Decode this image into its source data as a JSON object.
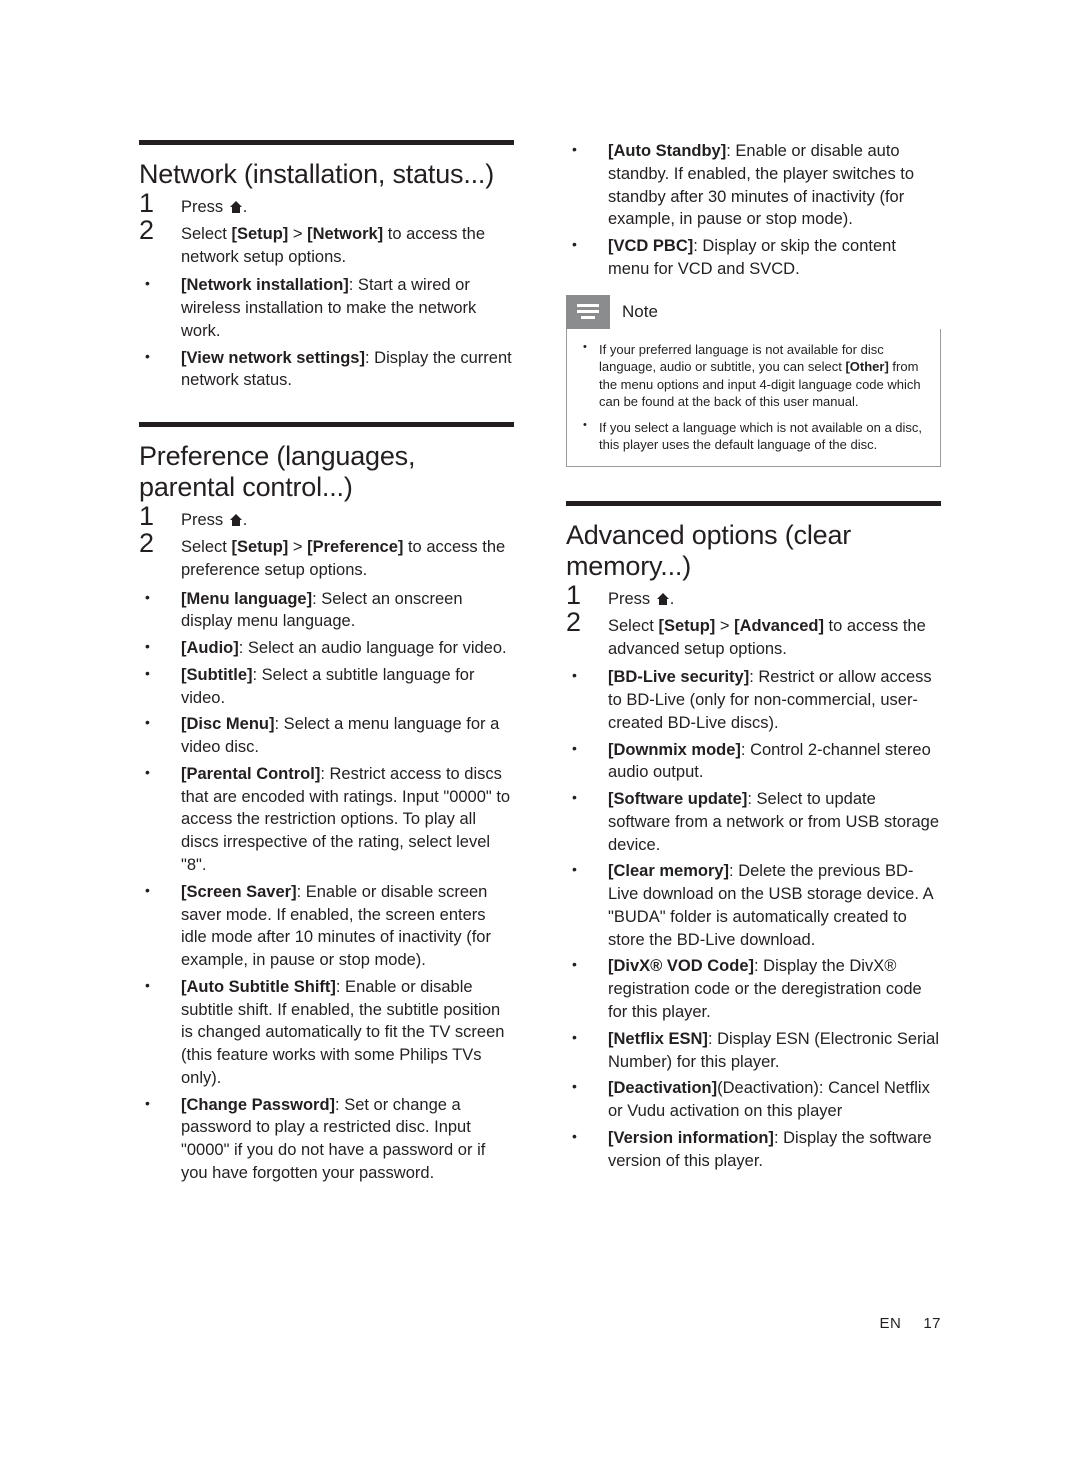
{
  "left_column": {
    "sections": [
      {
        "title": "Network (installation, status...)",
        "steps": [
          {
            "num": "1",
            "text": "Press ",
            "icon": "home-icon",
            "after": "."
          },
          {
            "num": "2",
            "text_parts": [
              "Select ",
              "[Setup]",
              " > ",
              "[Network]",
              " to access the network setup options."
            ]
          }
        ],
        "bullets": [
          {
            "term": "[Network installation]",
            "text": ": Start a wired or wireless installation to make the network work."
          },
          {
            "term": "[View network settings]",
            "text": ": Display the current network status."
          }
        ]
      },
      {
        "title": "Preference (languages, parental control...)",
        "steps": [
          {
            "num": "1",
            "text": "Press ",
            "icon": "home-icon",
            "after": "."
          },
          {
            "num": "2",
            "text_parts": [
              "Select ",
              "[Setup]",
              " > ",
              "[Preference]",
              " to access the preference setup options."
            ]
          }
        ],
        "bullets": [
          {
            "term": "[Menu language]",
            "text": ": Select an onscreen display menu language."
          },
          {
            "term": "[Audio]",
            "text": ": Select an audio language for video."
          },
          {
            "term": "[Subtitle]",
            "text": ": Select a subtitle language for video."
          },
          {
            "term": "[Disc Menu]",
            "text": ": Select a menu language for a video disc."
          },
          {
            "term": "[Parental Control]",
            "text": ": Restrict access to discs that are encoded with ratings. Input \"0000\" to access the restriction options. To play all discs irrespective of the rating, select level \"8\"."
          },
          {
            "term": "[Screen Saver]",
            "text": ": Enable or disable screen saver mode. If enabled, the screen enters idle mode after 10 minutes of inactivity (for example, in pause or stop mode)."
          },
          {
            "term": "[Auto Subtitle Shift]",
            "text": ": Enable or disable subtitle shift. If enabled, the subtitle position is changed automatically to fit the TV screen (this feature works with some Philips TVs only)."
          },
          {
            "term": "[Change Password]",
            "text": ": Set or change a password to play a restricted disc. Input \"0000\" if you do not have a password or if you have forgotten your password."
          }
        ]
      }
    ]
  },
  "right_column": {
    "top_bullets": [
      {
        "term": "[Auto Standby]",
        "text": ": Enable or disable auto standby. If enabled, the player switches to standby after 30 minutes of inactivity (for example, in pause or stop mode)."
      },
      {
        "term": "[VCD PBC]",
        "text": ": Display or skip the content menu for VCD and SVCD."
      }
    ],
    "note": {
      "title": "Note",
      "items": [
        {
          "pre": "If your preferred language is not available for disc language, audio or subtitle, you can select ",
          "term": "[Other]",
          "post": " from the menu options and input 4-digit language code which can be found at the back of this user manual."
        },
        {
          "pre": "If you select a language which is not available on a disc, this player uses the default language of the disc.",
          "term": "",
          "post": ""
        }
      ]
    },
    "section": {
      "title": "Advanced options (clear memory...)",
      "steps": [
        {
          "num": "1",
          "text": "Press ",
          "icon": "home-icon",
          "after": "."
        },
        {
          "num": "2",
          "text_parts": [
            "Select ",
            "[Setup]",
            " > ",
            "[Advanced]",
            " to access the advanced setup options."
          ]
        }
      ],
      "bullets": [
        {
          "term": "[BD-Live security]",
          "text": ": Restrict or allow access to BD-Live (only for non-commercial, user-created BD-Live discs)."
        },
        {
          "term": "[Downmix mode]",
          "text": ": Control 2-channel stereo audio output."
        },
        {
          "term": "[Software update]",
          "text": ": Select to update software from a network or from USB storage device."
        },
        {
          "term": "[Clear memory]",
          "text": ": Delete the previous BD-Live download on the USB storage device. A \"BUDA\" folder is automatically created to store the BD-Live download."
        },
        {
          "term": "[DivX® VOD Code]",
          "text": ": Display the DivX® registration code or the deregistration code for this player."
        },
        {
          "term": "[Netflix ESN]",
          "text": ": Display ESN (Electronic Serial Number) for this player."
        },
        {
          "term": "[Deactivation]",
          "text_plain": "(Deactivation): Cancel Netflix or Vudu activation on this player"
        },
        {
          "term": "[Version information]",
          "text": ": Display the software version of this player."
        }
      ]
    }
  },
  "footer": {
    "language": "EN",
    "page": "17"
  }
}
